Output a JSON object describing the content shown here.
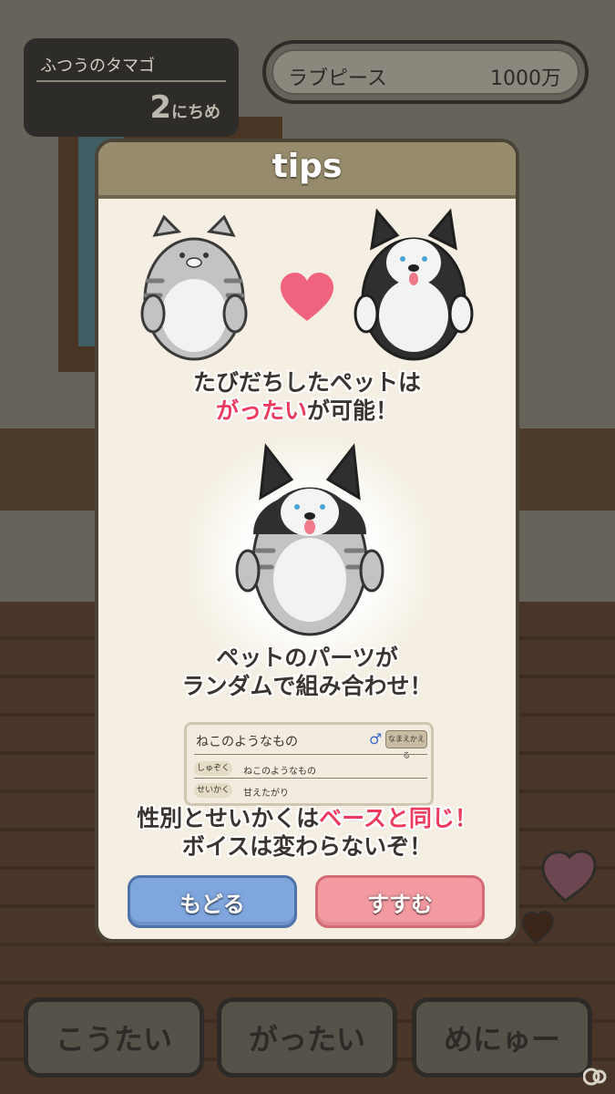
{
  "egg": {
    "name": "ふつうのタマゴ",
    "day_number": "2",
    "day_unit": "にちめ"
  },
  "love_piece": {
    "label": "ラブピース",
    "value": "1000万"
  },
  "dialog": {
    "title": "tips",
    "tip1": {
      "line1": "たびだちしたペットは",
      "highlight": "がったい",
      "line2_rest": "が可能！"
    },
    "tip2": {
      "line1": "ペットのパーツが",
      "line2": "ランダムで組み合わせ！"
    },
    "mini_card": {
      "name": "ねこのようなもの",
      "sex_symbol": "♂",
      "rename_button": "なまえかえる",
      "rows": [
        {
          "tag": "しゅぞく",
          "value": "ねこのようなもの"
        },
        {
          "tag": "せいかく",
          "value": "甘えたがり"
        }
      ]
    },
    "tip3": {
      "line1_prefix": "性別とせいかくは",
      "line1_highlight": "ベースと同じ！",
      "line2": "ボイスは変わらないぞ！"
    },
    "buttons": {
      "back": "もどる",
      "next": "すすむ"
    }
  },
  "bottom_nav": {
    "retreat": "こうたい",
    "merge": "がったい",
    "menu": "めにゅー"
  },
  "colors": {
    "accent_pink": "#ec3b5f",
    "back_blue": "#7fa6dd",
    "next_pink": "#f39ba1"
  }
}
